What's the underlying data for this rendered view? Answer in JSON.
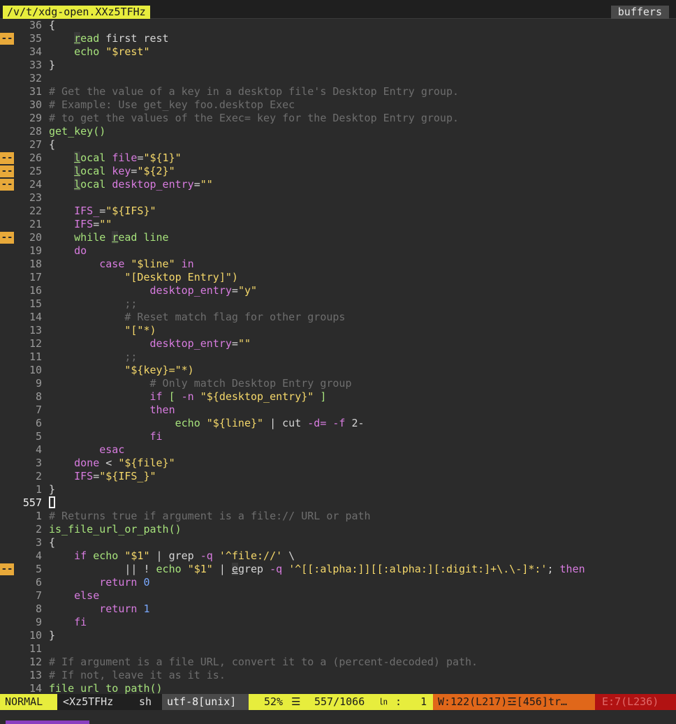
{
  "tabline": {
    "file": "/v/t/xdg-open.XXz5TFHz",
    "buffers_label": "buffers"
  },
  "colors": {
    "background": "#2b2b2b",
    "keyword": "#d87ce0",
    "builtin": "#a7e37c",
    "string": "#f5d86a",
    "comment": "#6e6e6e",
    "number": "#7aa9ff",
    "text": "#d6d6d6",
    "sign": "#e8a93a"
  },
  "lines": [
    {
      "sign": "",
      "num": "36",
      "tokens": [
        [
          "{",
          "text"
        ]
      ]
    },
    {
      "sign": "--",
      "num": "35",
      "tokens": [
        [
          "    ",
          "text"
        ],
        [
          "read",
          "builtin-u"
        ],
        [
          " first rest",
          "text"
        ]
      ]
    },
    {
      "sign": "",
      "num": "34",
      "tokens": [
        [
          "    ",
          "text"
        ],
        [
          "echo",
          "builtin"
        ],
        [
          " ",
          "text"
        ],
        [
          "\"$rest\"",
          "string"
        ]
      ]
    },
    {
      "sign": "",
      "num": "33",
      "tokens": [
        [
          "}",
          "text"
        ]
      ]
    },
    {
      "sign": "",
      "num": "32",
      "tokens": []
    },
    {
      "sign": "",
      "num": "31",
      "tokens": [
        [
          "# Get the value of a key in a desktop file's Desktop Entry group.",
          "comment"
        ]
      ]
    },
    {
      "sign": "",
      "num": "30",
      "tokens": [
        [
          "# Example: Use get_key foo.desktop Exec",
          "comment"
        ]
      ]
    },
    {
      "sign": "",
      "num": "29",
      "tokens": [
        [
          "# to get the values of the Exec= key for the Desktop Entry group.",
          "comment"
        ]
      ]
    },
    {
      "sign": "",
      "num": "28",
      "tokens": [
        [
          "get_key()",
          "builtin"
        ]
      ]
    },
    {
      "sign": "",
      "num": "27",
      "tokens": [
        [
          "{",
          "text"
        ]
      ]
    },
    {
      "sign": "--",
      "num": "26",
      "tokens": [
        [
          "    ",
          "text"
        ],
        [
          "local",
          "builtin-u"
        ],
        [
          " ",
          "text"
        ],
        [
          "file",
          "keyword"
        ],
        [
          "=",
          "text"
        ],
        [
          "\"${1}\"",
          "string"
        ]
      ]
    },
    {
      "sign": "--",
      "num": "25",
      "tokens": [
        [
          "    ",
          "text"
        ],
        [
          "local",
          "builtin-u"
        ],
        [
          " ",
          "text"
        ],
        [
          "key",
          "keyword"
        ],
        [
          "=",
          "text"
        ],
        [
          "\"${2}\"",
          "string"
        ]
      ]
    },
    {
      "sign": "--",
      "num": "24",
      "tokens": [
        [
          "    ",
          "text"
        ],
        [
          "local",
          "builtin-u"
        ],
        [
          " ",
          "text"
        ],
        [
          "desktop_entry",
          "keyword"
        ],
        [
          "=",
          "text"
        ],
        [
          "\"\"",
          "string"
        ]
      ]
    },
    {
      "sign": "",
      "num": "23",
      "tokens": []
    },
    {
      "sign": "",
      "num": "22",
      "tokens": [
        [
          "    ",
          "text"
        ],
        [
          "IFS_",
          "keyword"
        ],
        [
          "=",
          "text"
        ],
        [
          "\"${IFS}\"",
          "string"
        ]
      ]
    },
    {
      "sign": "",
      "num": "21",
      "tokens": [
        [
          "    ",
          "text"
        ],
        [
          "IFS",
          "keyword"
        ],
        [
          "=",
          "text"
        ],
        [
          "\"\"",
          "string"
        ]
      ]
    },
    {
      "sign": "--",
      "num": "20",
      "tokens": [
        [
          "    ",
          "text"
        ],
        [
          "while",
          "builtin"
        ],
        [
          " ",
          "text"
        ],
        [
          "read",
          "builtin-u"
        ],
        [
          " line",
          "builtin"
        ]
      ]
    },
    {
      "sign": "",
      "num": "19",
      "tokens": [
        [
          "    ",
          "text"
        ],
        [
          "do",
          "keyword"
        ]
      ]
    },
    {
      "sign": "",
      "num": "18",
      "tokens": [
        [
          "        ",
          "text"
        ],
        [
          "case",
          "keyword"
        ],
        [
          " ",
          "text"
        ],
        [
          "\"$line\"",
          "string"
        ],
        [
          " ",
          "text"
        ],
        [
          "in",
          "keyword"
        ]
      ]
    },
    {
      "sign": "",
      "num": "17",
      "tokens": [
        [
          "            ",
          "text"
        ],
        [
          "\"[Desktop Entry]\")",
          "string"
        ]
      ]
    },
    {
      "sign": "",
      "num": "16",
      "tokens": [
        [
          "                ",
          "text"
        ],
        [
          "desktop_entry",
          "keyword"
        ],
        [
          "=",
          "text"
        ],
        [
          "\"y\"",
          "string"
        ]
      ]
    },
    {
      "sign": "",
      "num": "15",
      "tokens": [
        [
          "            ",
          "text"
        ],
        [
          ";;",
          "comment"
        ]
      ]
    },
    {
      "sign": "",
      "num": "14",
      "tokens": [
        [
          "            ",
          "text"
        ],
        [
          "# Reset match flag for other groups",
          "comment"
        ]
      ]
    },
    {
      "sign": "",
      "num": "13",
      "tokens": [
        [
          "            ",
          "text"
        ],
        [
          "\"[\"*)",
          "string"
        ]
      ]
    },
    {
      "sign": "",
      "num": "12",
      "tokens": [
        [
          "                ",
          "text"
        ],
        [
          "desktop_entry",
          "keyword"
        ],
        [
          "=",
          "text"
        ],
        [
          "\"\"",
          "string"
        ]
      ]
    },
    {
      "sign": "",
      "num": "11",
      "tokens": [
        [
          "            ",
          "text"
        ],
        [
          ";;",
          "comment"
        ]
      ]
    },
    {
      "sign": "",
      "num": "10",
      "tokens": [
        [
          "            ",
          "text"
        ],
        [
          "\"${key}=\"*)",
          "string"
        ]
      ]
    },
    {
      "sign": "",
      "num": "9",
      "tokens": [
        [
          "                ",
          "text"
        ],
        [
          "# Only match Desktop Entry group",
          "comment"
        ]
      ]
    },
    {
      "sign": "",
      "num": "8",
      "tokens": [
        [
          "                ",
          "text"
        ],
        [
          "if",
          "keyword"
        ],
        [
          " ",
          "text"
        ],
        [
          "[",
          "builtin"
        ],
        [
          " ",
          "text"
        ],
        [
          "-n",
          "keyword"
        ],
        [
          " ",
          "text"
        ],
        [
          "\"${desktop_entry}\"",
          "string"
        ],
        [
          " ",
          "text"
        ],
        [
          "]",
          "builtin"
        ]
      ]
    },
    {
      "sign": "",
      "num": "7",
      "tokens": [
        [
          "                ",
          "text"
        ],
        [
          "then",
          "keyword"
        ]
      ]
    },
    {
      "sign": "",
      "num": "6",
      "tokens": [
        [
          "                    ",
          "text"
        ],
        [
          "echo",
          "builtin"
        ],
        [
          " ",
          "text"
        ],
        [
          "\"${line}\"",
          "string"
        ],
        [
          " | cut ",
          "text"
        ],
        [
          "-d=",
          "keyword"
        ],
        [
          " ",
          "text"
        ],
        [
          "-f",
          "keyword"
        ],
        [
          " 2-",
          "text"
        ]
      ]
    },
    {
      "sign": "",
      "num": "5",
      "tokens": [
        [
          "                ",
          "text"
        ],
        [
          "fi",
          "keyword"
        ]
      ]
    },
    {
      "sign": "",
      "num": "4",
      "tokens": [
        [
          "        ",
          "text"
        ],
        [
          "esac",
          "keyword"
        ]
      ]
    },
    {
      "sign": "",
      "num": "3",
      "tokens": [
        [
          "    ",
          "text"
        ],
        [
          "done",
          "keyword"
        ],
        [
          " < ",
          "text"
        ],
        [
          "\"${file}\"",
          "string"
        ]
      ]
    },
    {
      "sign": "",
      "num": "2",
      "tokens": [
        [
          "    ",
          "text"
        ],
        [
          "IFS",
          "keyword"
        ],
        [
          "=",
          "text"
        ],
        [
          "\"${IFS_}\"",
          "string"
        ]
      ]
    },
    {
      "sign": "",
      "num": "1",
      "tokens": [
        [
          "}",
          "text"
        ]
      ]
    },
    {
      "sign": "",
      "num": "557",
      "current": true,
      "tokens": []
    },
    {
      "sign": "",
      "num": "1",
      "tokens": [
        [
          "# Returns true if argument is a file:// URL or path",
          "comment"
        ]
      ]
    },
    {
      "sign": "",
      "num": "2",
      "tokens": [
        [
          "is_file_url_or_path()",
          "builtin"
        ]
      ]
    },
    {
      "sign": "",
      "num": "3",
      "tokens": [
        [
          "{",
          "text"
        ]
      ]
    },
    {
      "sign": "",
      "num": "4",
      "tokens": [
        [
          "    ",
          "text"
        ],
        [
          "if",
          "keyword"
        ],
        [
          " ",
          "text"
        ],
        [
          "echo",
          "builtin"
        ],
        [
          " ",
          "text"
        ],
        [
          "\"$1\"",
          "string"
        ],
        [
          " | grep ",
          "text"
        ],
        [
          "-q",
          "keyword"
        ],
        [
          " ",
          "text"
        ],
        [
          "'^file://'",
          "string"
        ],
        [
          " \\",
          "text"
        ]
      ]
    },
    {
      "sign": "--",
      "num": "5",
      "tokens": [
        [
          "            || ! ",
          "text"
        ],
        [
          "echo",
          "builtin"
        ],
        [
          " ",
          "text"
        ],
        [
          "\"$1\"",
          "string"
        ],
        [
          " | ",
          "text"
        ],
        [
          "egrep",
          "text-u"
        ],
        [
          " ",
          "text"
        ],
        [
          "-q",
          "keyword"
        ],
        [
          " ",
          "text"
        ],
        [
          "'^[[:alpha:]][[:alpha:][:digit:]+\\.\\-]*:'",
          "string"
        ],
        [
          "; ",
          "text"
        ],
        [
          "then",
          "keyword"
        ]
      ]
    },
    {
      "sign": "",
      "num": "6",
      "tokens": [
        [
          "        ",
          "text"
        ],
        [
          "return",
          "keyword"
        ],
        [
          " ",
          "text"
        ],
        [
          "0",
          "number"
        ]
      ]
    },
    {
      "sign": "",
      "num": "7",
      "tokens": [
        [
          "    ",
          "text"
        ],
        [
          "else",
          "keyword"
        ]
      ]
    },
    {
      "sign": "",
      "num": "8",
      "tokens": [
        [
          "        ",
          "text"
        ],
        [
          "return",
          "keyword"
        ],
        [
          " ",
          "text"
        ],
        [
          "1",
          "number"
        ]
      ]
    },
    {
      "sign": "",
      "num": "9",
      "tokens": [
        [
          "    ",
          "text"
        ],
        [
          "fi",
          "keyword"
        ]
      ]
    },
    {
      "sign": "",
      "num": "10",
      "tokens": [
        [
          "}",
          "text"
        ]
      ]
    },
    {
      "sign": "",
      "num": "11",
      "tokens": []
    },
    {
      "sign": "",
      "num": "12",
      "tokens": [
        [
          "# If argument is a file URL, convert it to a (percent-decoded) path.",
          "comment"
        ]
      ]
    },
    {
      "sign": "",
      "num": "13",
      "tokens": [
        [
          "# If not, leave it as it is.",
          "comment"
        ]
      ]
    },
    {
      "sign": "",
      "num": "14",
      "tokens": [
        [
          "file_url_to_path()",
          "builtin"
        ]
      ]
    }
  ],
  "statusline": {
    "mode": "NORMAL",
    "buffer": "<Xz5TFHz",
    "filetype": "sh",
    "encoding": "utf-8[unix]",
    "percent": "52%",
    "menu_icon": "☰",
    "position": "557/1066",
    "ln_icon": "㏑",
    "column": ":   1",
    "warnings": "W:122(L217)☲[456]tr…",
    "errors": "E:7(L236)"
  }
}
